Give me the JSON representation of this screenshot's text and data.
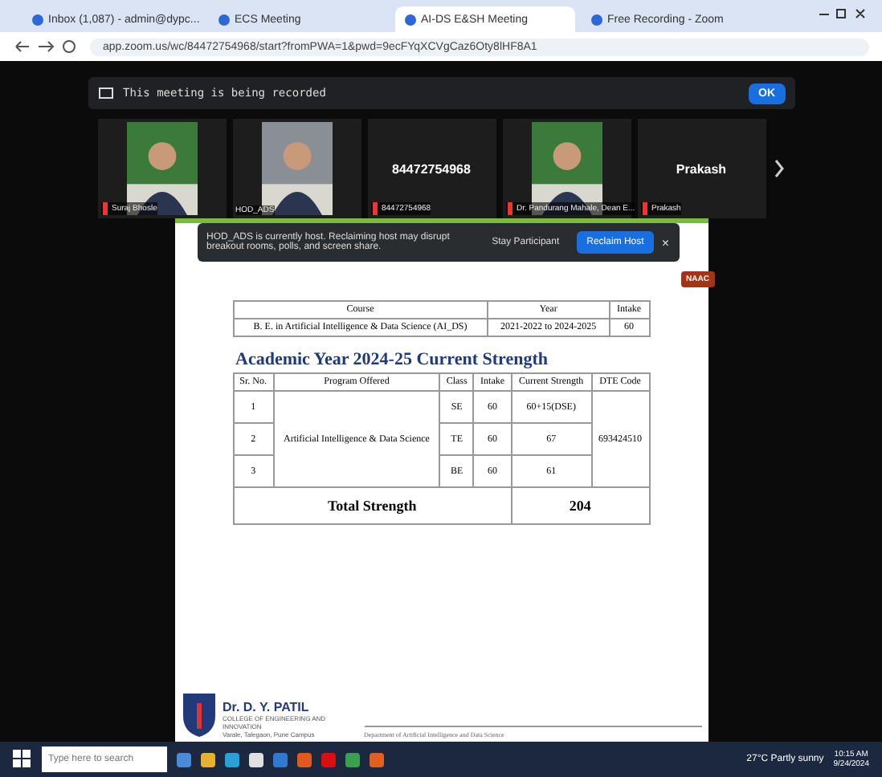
{
  "browser": {
    "tabs": [
      {
        "label": "Inbox (1,087) - admin@dypc...",
        "selected": false
      },
      {
        "label": "ECS Meeting",
        "selected": false
      },
      {
        "label": "AI-DS E&SH Meeting",
        "selected": true
      },
      {
        "label": "Free Recording - Zoom",
        "selected": false
      }
    ],
    "address": "app.zoom.us/wc/84472754968/start?fromPWA=1&pwd=9ecFYqXCVgCaz6Oty8lHF8A1"
  },
  "meeting": {
    "recording_banner": "This meeting is being recorded",
    "ok_button": "OK",
    "participants": [
      {
        "name": "Suraj Bhosle",
        "video": true,
        "muted": true
      },
      {
        "name": "HOD_ADS",
        "video": true,
        "muted": false
      },
      {
        "name": "84472754968",
        "video": false,
        "tile_title": "84472754968",
        "muted": true
      },
      {
        "name": "Dr. Pandurang Mahale, Dean E...",
        "video": true,
        "muted": true
      },
      {
        "name": "Prakash",
        "video": false,
        "tile_title": "Prakash",
        "muted": true
      }
    ],
    "host_notice": {
      "message": "HOD_ADS is currently host. Reclaiming host may disrupt breakout rooms, polls, and screen share.",
      "stay_button": "Stay Participant",
      "reclaim_button": "Reclaim Host",
      "close": "×"
    }
  },
  "slide": {
    "badge": "NAAC",
    "course_table": {
      "columns": [
        "Course",
        "Year",
        "Intake"
      ],
      "rows": [
        [
          "B. E. in Artificial Intelligence & Data Science (AI_DS)",
          "2021-2022 to 2024-2025",
          "60"
        ]
      ]
    },
    "heading": "Academic Year 2024-25 Current Strength",
    "strength_table": {
      "columns": [
        "Sr. No.",
        "Program Offered",
        "Class",
        "Intake",
        "Current Strength",
        "DTE Code"
      ],
      "rows": [
        [
          "1",
          "",
          "SE",
          "60",
          "60+15(DSE)",
          ""
        ],
        [
          "2",
          "Artificial Intelligence & Data Science",
          "TE",
          "60",
          "67",
          "693424510"
        ],
        [
          "3",
          "",
          "BE",
          "60",
          "61",
          ""
        ]
      ],
      "total_label": "Total Strength",
      "total": "204"
    },
    "college": {
      "name": "Dr. D. Y. PATIL",
      "line1": "COLLEGE OF ENGINEERING AND",
      "line2": "INNOVATION",
      "line3": "Varale, Talegaon, Pune Campus"
    },
    "footer": "Department of Artificial Intelligence and Data Science"
  },
  "taskbar": {
    "search_placeholder": "Type here to search",
    "weather": "27°C Partly sunny",
    "time": "10:15 AM",
    "date": "9/24/2024"
  }
}
